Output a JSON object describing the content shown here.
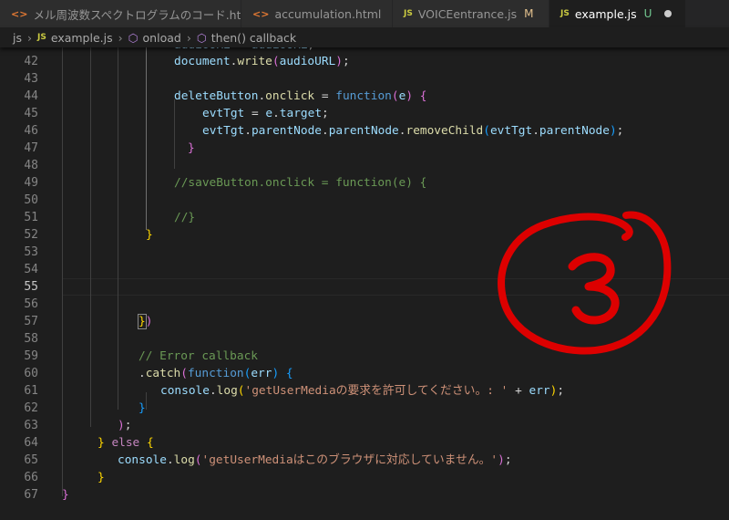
{
  "tabs": [
    {
      "label": "メル周波数スペクトログラムのコード.html",
      "icon": "html-icon",
      "badge": ""
    },
    {
      "label": "accumulation.html",
      "icon": "html-icon",
      "badge": ""
    },
    {
      "label": "VOICEentrance.js",
      "icon": "js-icon",
      "badge": "M"
    },
    {
      "label": "example.js",
      "icon": "js-icon",
      "badge": "U"
    }
  ],
  "breadcrumb": {
    "folder": "js",
    "file": "example.js",
    "symbol1": "onload",
    "symbol2": "then() callback"
  },
  "editor": {
    "current_line": 55,
    "lines": [
      {
        "n": "42",
        "code": "document.write(audioURL);"
      },
      {
        "n": "43",
        "code": ""
      },
      {
        "n": "44",
        "code": "deleteButton.onclick = function(e) {"
      },
      {
        "n": "45",
        "code": "evtTgt = e.target;"
      },
      {
        "n": "46",
        "code": "evtTgt.parentNode.parentNode.removeChild(evtTgt.parentNode);"
      },
      {
        "n": "47",
        "code": "}"
      },
      {
        "n": "48",
        "code": ""
      },
      {
        "n": "49",
        "code": "//saveButton.onclick = function(e) {"
      },
      {
        "n": "50",
        "code": ""
      },
      {
        "n": "51",
        "code": "//}"
      },
      {
        "n": "52",
        "code": "}"
      },
      {
        "n": "53",
        "code": ""
      },
      {
        "n": "54",
        "code": ""
      },
      {
        "n": "55",
        "code": ""
      },
      {
        "n": "56",
        "code": ""
      },
      {
        "n": "57",
        "code": "})"
      },
      {
        "n": "58",
        "code": ""
      },
      {
        "n": "59",
        "code": "// Error callback"
      },
      {
        "n": "60",
        "code": ".catch(function(err) {"
      },
      {
        "n": "61",
        "code": "console.log('getUserMediaの要求を許可してください。: ' + err);"
      },
      {
        "n": "62",
        "code": "}"
      },
      {
        "n": "63",
        "code": ");"
      },
      {
        "n": "64",
        "code": "} else {"
      },
      {
        "n": "65",
        "code": "console.log('getUserMediaはこのブラウザに対応していません。');"
      },
      {
        "n": "66",
        "code": "}"
      },
      {
        "n": "67",
        "code": "}"
      }
    ]
  },
  "annotation": {
    "text": "3",
    "color": "#dd0000"
  }
}
